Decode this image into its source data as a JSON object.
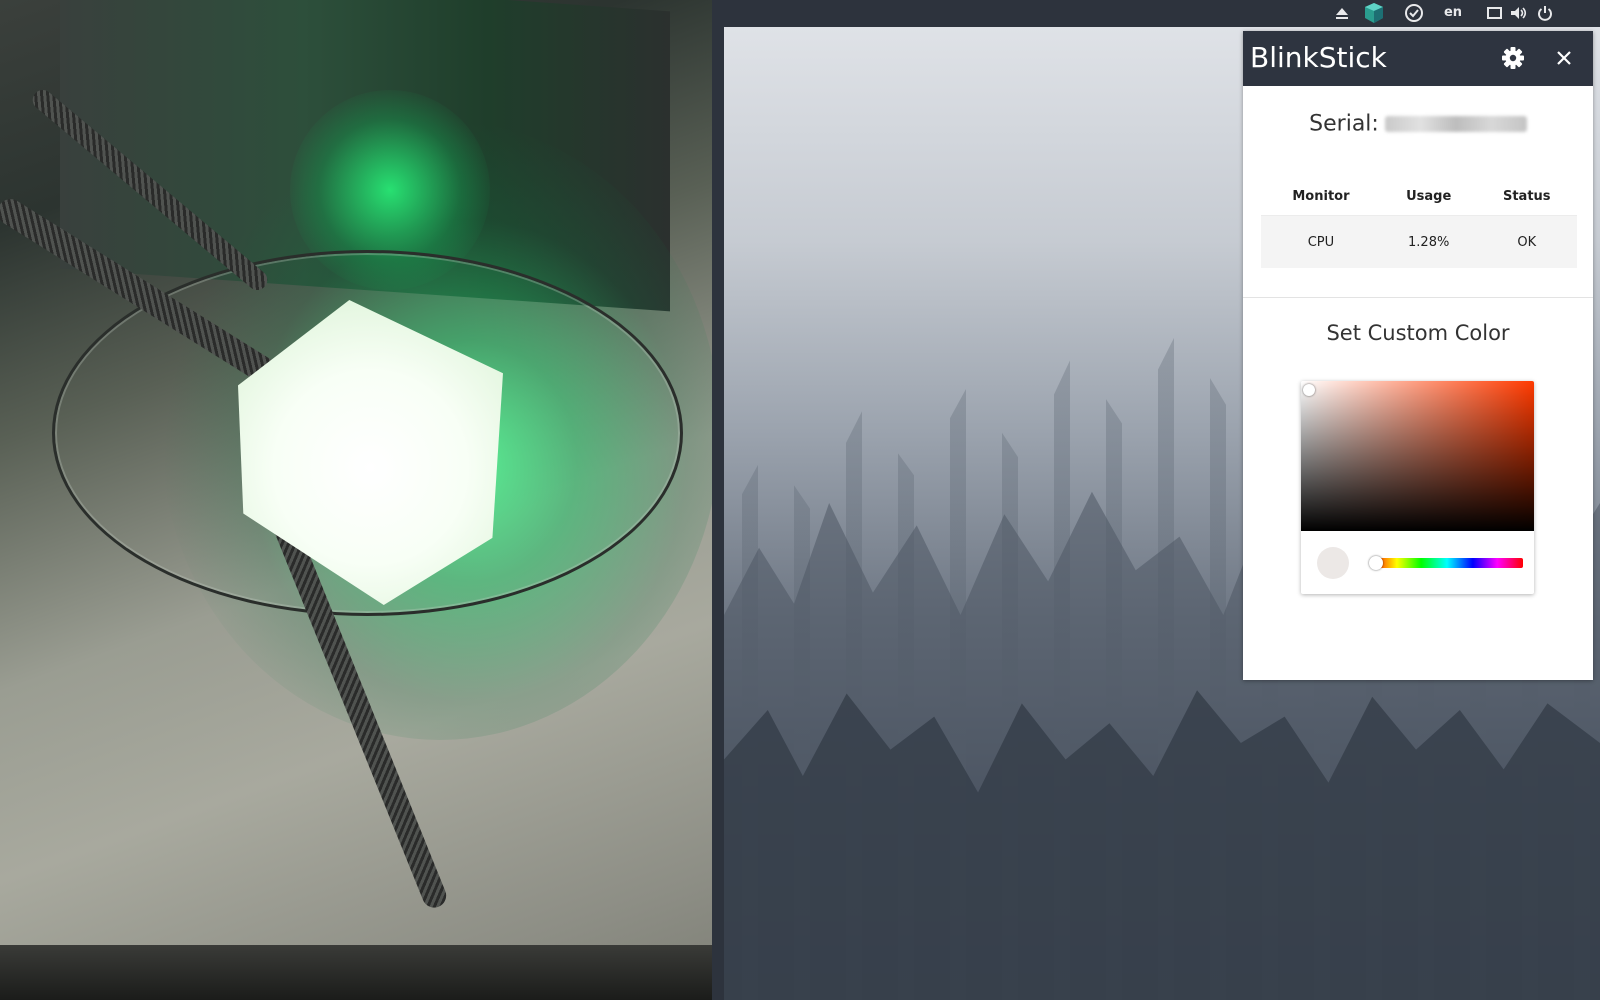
{
  "tray": {
    "language": "en",
    "icons": [
      "eject-icon",
      "blinkstick-cube-icon",
      "checkmark-circle-icon",
      "window-icon",
      "volume-icon",
      "power-icon"
    ]
  },
  "panel": {
    "title": "BlinkStick",
    "serial_label": "Serial:",
    "table": {
      "headers": [
        "Monitor",
        "Usage",
        "Status"
      ],
      "rows": [
        {
          "monitor": "CPU",
          "usage": "1.28%",
          "status": "OK"
        }
      ]
    },
    "custom_color_title": "Set Custom Color",
    "picker": {
      "hue_color": "#ff3a00",
      "current_color": "#ece8e6",
      "hue_level": 0.0
    }
  },
  "colors": {
    "panel_header": "#2e3440",
    "topbar": "#2d333d",
    "led_glow": "#2bea7a"
  }
}
